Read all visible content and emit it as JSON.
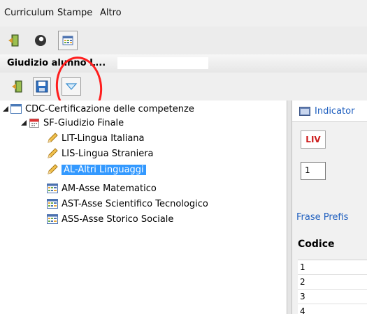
{
  "menu": [
    "Curriculum",
    "Stampe",
    "Altro"
  ],
  "window": {
    "title": "Giudizio alunno L..."
  },
  "tree": {
    "root": "CDC-Certificazione delle competenze",
    "child": "SF-Giudizio Finale",
    "items": [
      {
        "label": "LIT-Lingua Italiana",
        "icon": "pencil-icon"
      },
      {
        "label": "LIS-Lingua Straniera",
        "icon": "pencil-icon"
      },
      {
        "label": "AL-Altri Linguaggi",
        "icon": "pencil-icon",
        "selected": true
      },
      {
        "label": "AM-Asse Matematico",
        "icon": "grid-icon"
      },
      {
        "label": "AST-Asse Scientifico Tecnologico",
        "icon": "grid-icon"
      },
      {
        "label": "ASS-Asse Storico Sociale",
        "icon": "grid-icon"
      }
    ]
  },
  "right": {
    "tab_label": "Indicator",
    "liv_button": "LIV",
    "liv_value": "1",
    "frase_label": "Frase Prefis",
    "table_header": "Codice",
    "rows": [
      "1",
      "2",
      "3",
      "4"
    ]
  },
  "colors": {
    "selection": "#3399ff",
    "link": "#1f5fbf",
    "annotation": "#ff1d1d",
    "liv": "#cc1b1b"
  }
}
